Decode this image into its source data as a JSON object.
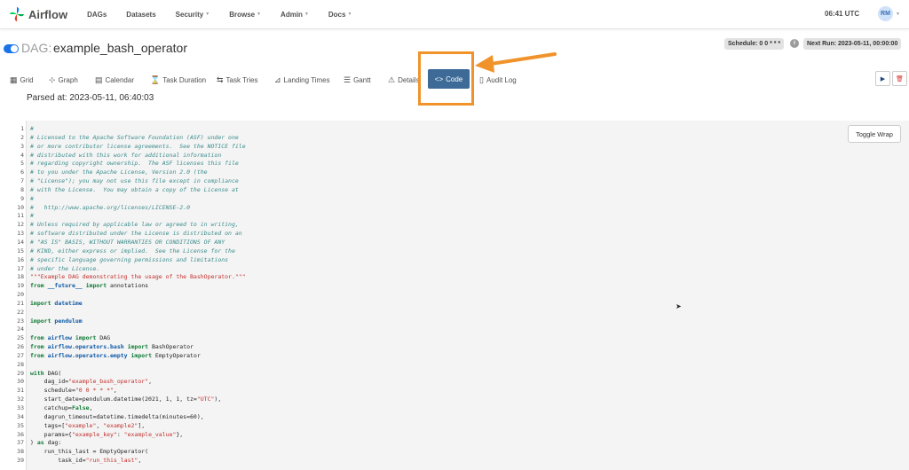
{
  "nav": {
    "brand": "Airflow",
    "items": [
      {
        "label": "DAGs",
        "dropdown": false
      },
      {
        "label": "Datasets",
        "dropdown": false
      },
      {
        "label": "Security",
        "dropdown": true
      },
      {
        "label": "Browse",
        "dropdown": true
      },
      {
        "label": "Admin",
        "dropdown": true
      },
      {
        "label": "Docs",
        "dropdown": true
      }
    ],
    "time": "06:41 UTC",
    "user_initials": "RM"
  },
  "dag": {
    "prefix": "DAG:",
    "name": "example_bash_operator",
    "schedule": "Schedule: 0 0 * * *",
    "next_run": "Next Run: 2023-05-11, 00:00:00"
  },
  "tabs": [
    {
      "label": "Grid",
      "icon": "grid-icon",
      "glyph": "▦"
    },
    {
      "label": "Graph",
      "icon": "graph-icon",
      "glyph": "⊹"
    },
    {
      "label": "Calendar",
      "icon": "calendar-icon",
      "glyph": "▤"
    },
    {
      "label": "Task Duration",
      "icon": "hourglass-icon",
      "glyph": "⌛"
    },
    {
      "label": "Task Tries",
      "icon": "retry-icon",
      "glyph": "⇆"
    },
    {
      "label": "Landing Times",
      "icon": "landing-icon",
      "glyph": "⊿"
    },
    {
      "label": "Gantt",
      "icon": "gantt-icon",
      "glyph": "☰"
    },
    {
      "label": "Details",
      "icon": "warning-icon",
      "glyph": "⚠"
    },
    {
      "label": "Code",
      "icon": "code-icon",
      "glyph": "<>"
    },
    {
      "label": "Audit Log",
      "icon": "audit-log-icon",
      "glyph": "▯"
    }
  ],
  "parsed_at": "Parsed at: 2023-05-11, 06:40:03",
  "toggle_wrap": "Toggle Wrap",
  "colors": {
    "accent": "#3d6a96",
    "highlight": "#f0932b",
    "toggle": "#1a73e8"
  },
  "code": [
    "#",
    "# Licensed to the Apache Software Foundation (ASF) under one",
    "# or more contributor license agreements.  See the NOTICE file",
    "# distributed with this work for additional information",
    "# regarding copyright ownership.  The ASF licenses this file",
    "# to you under the Apache License, Version 2.0 (the",
    "# \"License\"); you may not use this file except in compliance",
    "# with the License.  You may obtain a copy of the License at",
    "#",
    "#   http://www.apache.org/licenses/LICENSE-2.0",
    "#",
    "# Unless required by applicable law or agreed to in writing,",
    "# software distributed under the License is distributed on an",
    "# \"AS IS\" BASIS, WITHOUT WARRANTIES OR CONDITIONS OF ANY",
    "# KIND, either express or implied.  See the License for the",
    "# specific language governing permissions and limitations",
    "# under the License.",
    "\"\"\"Example DAG demonstrating the usage of the BashOperator.\"\"\"",
    "from __future__ import annotations",
    "",
    "import datetime",
    "",
    "import pendulum",
    "",
    "from airflow import DAG",
    "from airflow.operators.bash import BashOperator",
    "from airflow.operators.empty import EmptyOperator",
    "",
    "with DAG(",
    "    dag_id=\"example_bash_operator\",",
    "    schedule=\"0 0 * * *\",",
    "    start_date=pendulum.datetime(2021, 1, 1, tz=\"UTC\"),",
    "    catchup=False,",
    "    dagrun_timeout=datetime.timedelta(minutes=60),",
    "    tags=[\"example\", \"example2\"],",
    "    params={\"example_key\": \"example_value\"},",
    ") as dag:",
    "    run_this_last = EmptyOperator(",
    "        task_id=\"run_this_last\","
  ]
}
